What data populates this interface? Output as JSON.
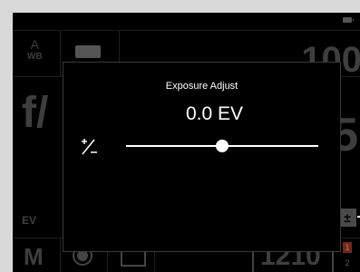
{
  "background": {
    "wb": {
      "top": "A",
      "bottom": "WB"
    },
    "iso": "100",
    "aperture": "f/",
    "shutter": "5",
    "ev_label": "EV",
    "mode": "M",
    "shots_remaining": "1210",
    "card_slot_1": "1",
    "card_slot_2": "2",
    "icons": [
      "battery-icon",
      "af-icon",
      "exposure-comp-icon",
      "record-icon",
      "frame-icon"
    ]
  },
  "dialog": {
    "title": "Exposure Adjust",
    "value": "0.0 EV",
    "icon": "plus-minus-icon",
    "slider_position": 0.5
  },
  "colors": {
    "dialog_text": "#ffffff",
    "background_text": "#3e3e3e",
    "card_badge": "#6e2a1a"
  }
}
